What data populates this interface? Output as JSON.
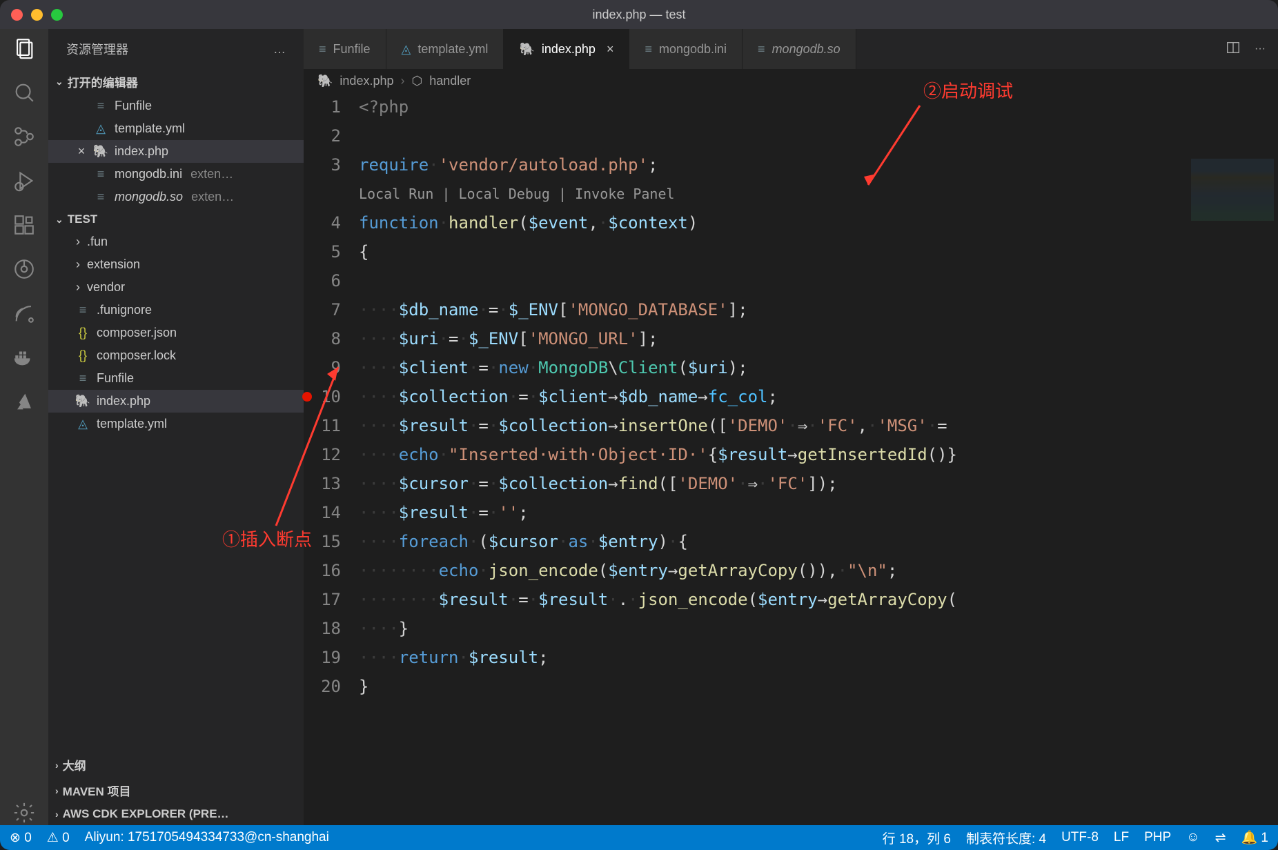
{
  "window": {
    "title": "index.php — test"
  },
  "sidebar": {
    "explorer_label": "资源管理器",
    "more_label": "…",
    "open_editors_label": "打开的编辑器",
    "open_editors": [
      {
        "icon": "≡",
        "iconClass": "ic-gray",
        "label": "Funfile",
        "close": ""
      },
      {
        "icon": "◬",
        "iconClass": "ic-blue",
        "label": "template.yml",
        "close": ""
      },
      {
        "icon": "🐘",
        "iconClass": "ic-purple",
        "label": "index.php",
        "close": "×",
        "active": true
      },
      {
        "icon": "≡",
        "iconClass": "ic-gray",
        "label": "mongodb.ini",
        "suffix": "exten…",
        "close": ""
      },
      {
        "icon": "≡",
        "iconClass": "ic-gray",
        "label": "mongodb.so",
        "suffix": "exten…",
        "italic": true,
        "close": ""
      }
    ],
    "folder_label": "TEST",
    "files": [
      {
        "type": "dir",
        "label": ".fun"
      },
      {
        "type": "dir",
        "label": "extension"
      },
      {
        "type": "dir",
        "label": "vendor"
      },
      {
        "type": "file",
        "icon": "≡",
        "iconClass": "ic-gray",
        "label": ".funignore"
      },
      {
        "type": "file",
        "icon": "{}",
        "iconClass": "ic-yellow",
        "label": "composer.json"
      },
      {
        "type": "file",
        "icon": "{}",
        "iconClass": "ic-yellow",
        "label": "composer.lock"
      },
      {
        "type": "file",
        "icon": "≡",
        "iconClass": "ic-gray",
        "label": "Funfile"
      },
      {
        "type": "file",
        "icon": "🐘",
        "iconClass": "ic-purple",
        "label": "index.php",
        "active": true
      },
      {
        "type": "file",
        "icon": "◬",
        "iconClass": "ic-blue",
        "label": "template.yml"
      }
    ],
    "outline_label": "大纲",
    "maven_label": "MAVEN 项目",
    "aws_label": "AWS CDK EXPLORER (PRE…"
  },
  "tabs": [
    {
      "icon": "≡",
      "iconClass": "ic-gray",
      "label": "Funfile"
    },
    {
      "icon": "◬",
      "iconClass": "ic-blue",
      "label": "template.yml"
    },
    {
      "icon": "🐘",
      "iconClass": "ic-purple",
      "label": "index.php",
      "active": true,
      "close": "×"
    },
    {
      "icon": "≡",
      "iconClass": "ic-gray",
      "label": "mongodb.ini"
    },
    {
      "icon": "≡",
      "iconClass": "ic-gray",
      "label": "mongodb.so",
      "italic": true
    }
  ],
  "breadcrumb": {
    "file_icon": "🐘",
    "file": "index.php",
    "sep": "›",
    "symbol_icon": "⬡",
    "symbol": "handler"
  },
  "codelens": "Local Run | Local Debug | Invoke Panel",
  "code": {
    "lines": [
      1,
      2,
      3,
      4,
      5,
      6,
      7,
      8,
      9,
      10,
      11,
      12,
      13,
      14,
      15,
      16,
      17,
      18,
      19,
      20
    ],
    "breakpoint_line": 10
  },
  "annotations": {
    "a1": "①插入断点",
    "a2": "②启动调试"
  },
  "statusbar": {
    "errors": "⊗ 0",
    "warnings": "⚠ 0",
    "account": "Aliyun: 1751705494334733@cn-shanghai",
    "cursor": "行 18，列 6",
    "tabsize": "制表符长度: 4",
    "encoding": "UTF-8",
    "eol": "LF",
    "lang": "PHP",
    "feedback_icon": "☺",
    "bell": "🔔 1"
  }
}
